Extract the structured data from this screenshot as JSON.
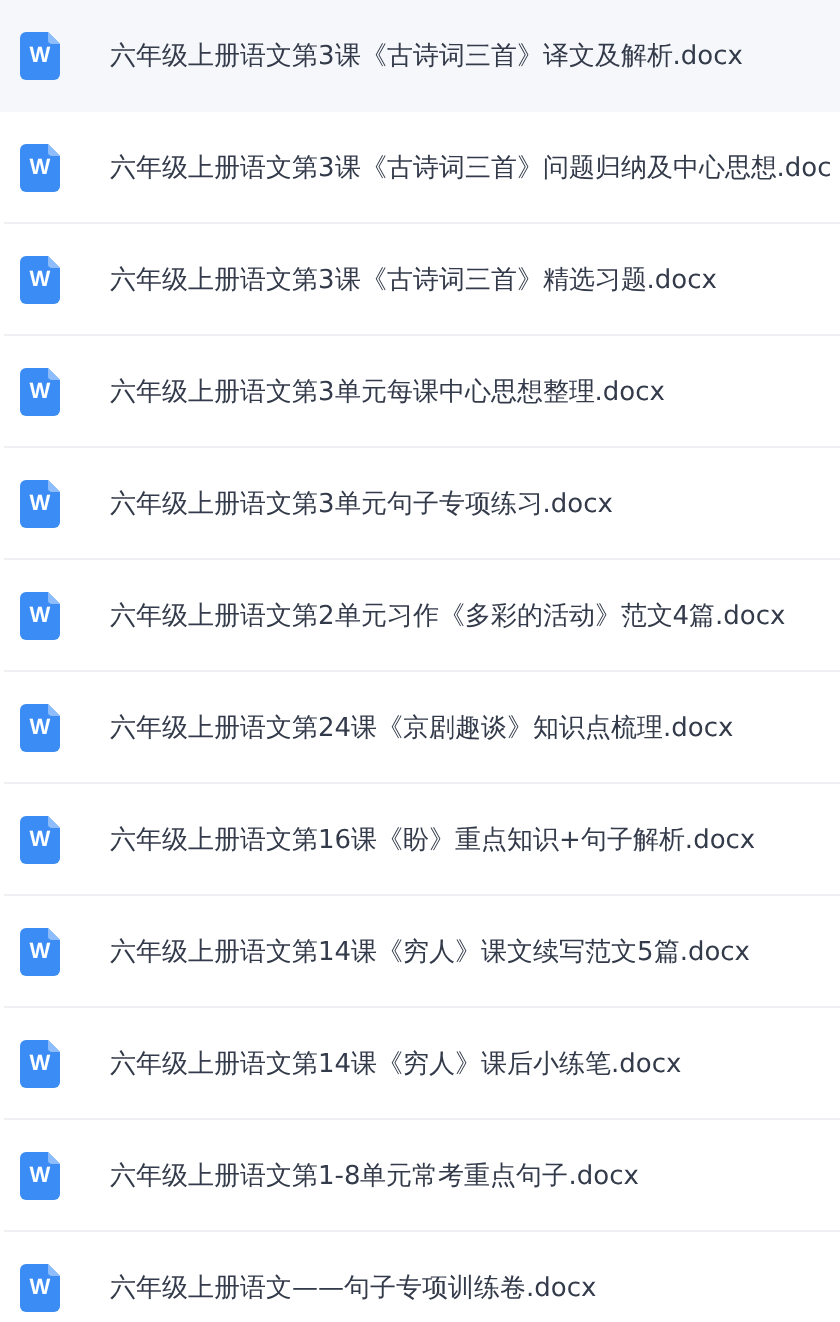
{
  "files": [
    {
      "name": "六年级上册语文第3课《古诗词三首》译文及解析.docx",
      "icon_label": "W",
      "selected": true
    },
    {
      "name": "六年级上册语文第3课《古诗词三首》问题归纳及中心思想.doc",
      "icon_label": "W",
      "selected": false
    },
    {
      "name": "六年级上册语文第3课《古诗词三首》精选习题.docx",
      "icon_label": "W",
      "selected": false
    },
    {
      "name": "六年级上册语文第3单元每课中心思想整理.docx",
      "icon_label": "W",
      "selected": false
    },
    {
      "name": "六年级上册语文第3单元句子专项练习.docx",
      "icon_label": "W",
      "selected": false
    },
    {
      "name": "六年级上册语文第2单元习作《多彩的活动》范文4篇.docx",
      "icon_label": "W",
      "selected": false
    },
    {
      "name": "六年级上册语文第24课《京剧趣谈》知识点梳理.docx",
      "icon_label": "W",
      "selected": false
    },
    {
      "name": "六年级上册语文第16课《盼》重点知识+句子解析.docx",
      "icon_label": "W",
      "selected": false
    },
    {
      "name": "六年级上册语文第14课《穷人》课文续写范文5篇.docx",
      "icon_label": "W",
      "selected": false
    },
    {
      "name": "六年级上册语文第14课《穷人》课后小练笔.docx",
      "icon_label": "W",
      "selected": false
    },
    {
      "name": "六年级上册语文第1-8单元常考重点句子.docx",
      "icon_label": "W",
      "selected": false
    },
    {
      "name": "六年级上册语文——句子专项训练卷.docx",
      "icon_label": "W",
      "selected": false
    }
  ]
}
